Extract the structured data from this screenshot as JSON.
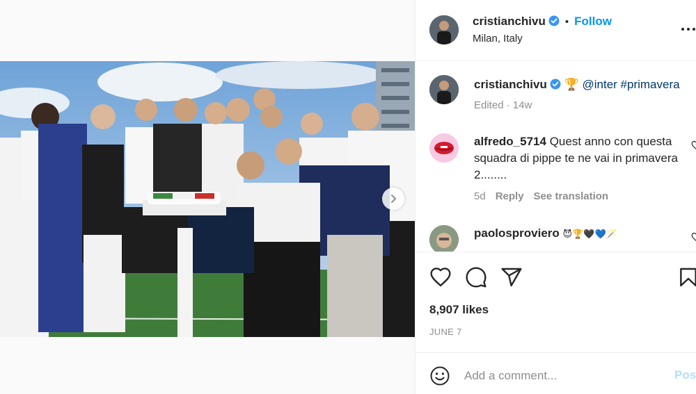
{
  "header": {
    "username": "cristianchivu",
    "separator": "•",
    "follow_label": "Follow",
    "location": "Milan, Italy"
  },
  "caption": {
    "username": "cristianchivu",
    "text": "🏆 @inter #primavera",
    "edited": "Edited · 14w"
  },
  "comments": [
    {
      "username": "alfredo_5714",
      "text": "Quest anno con questa squadra di pippe te ne vai in primavera 2........",
      "age": "5d",
      "reply_label": "Reply",
      "translation_label": "See translation"
    },
    {
      "username": "paolosproviero",
      "text": "😈🏆🖤💙🪄"
    }
  ],
  "likes": "8,907 likes",
  "date": "JUNE 7",
  "add_comment": {
    "placeholder": "Add a comment...",
    "post_label": "Post"
  },
  "colors": {
    "accent": "#0095f6",
    "verified": "#3897f0",
    "muted": "#8e8e8e",
    "post_disabled": "#b2dffc"
  },
  "icons": [
    "verified-badge-icon",
    "more-options-icon",
    "chevron-right-icon",
    "heart-icon",
    "comment-icon",
    "share-icon",
    "bookmark-icon",
    "emoji-icon"
  ]
}
